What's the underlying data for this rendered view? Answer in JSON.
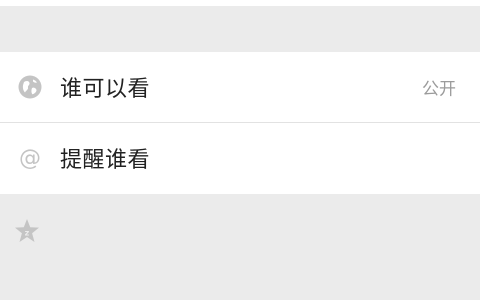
{
  "settings": {
    "rows": [
      {
        "label": "谁可以看",
        "value": "公开",
        "icon": "globe-icon"
      },
      {
        "label": "提醒谁看",
        "value": "",
        "icon": "at-icon"
      }
    ]
  },
  "footer": {
    "icon": "star-icon"
  },
  "colors": {
    "background": "#ebebeb",
    "card": "#ffffff",
    "label": "#222222",
    "value": "#9b9b9b",
    "icon": "#c4c4c4"
  }
}
